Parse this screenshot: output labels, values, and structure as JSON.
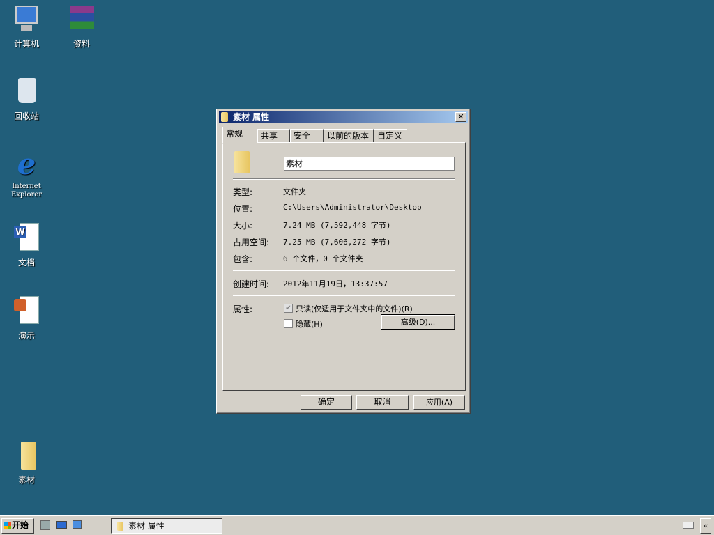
{
  "desktop": {
    "icons": [
      {
        "label": "计算机"
      },
      {
        "label": "资料"
      },
      {
        "label": "回收站"
      },
      {
        "label": "Internet Explorer"
      },
      {
        "label": "文档"
      },
      {
        "label": "演示"
      },
      {
        "label": "素材"
      }
    ]
  },
  "dialog": {
    "title": "素材 属性",
    "close": "✕",
    "tabs": [
      "常规",
      "共享",
      "安全",
      "以前的版本",
      "自定义"
    ],
    "name_value": "素材",
    "rows": [
      {
        "label": "类型:",
        "value": "文件夹"
      },
      {
        "label": "位置:",
        "value": "C:\\Users\\Administrator\\Desktop"
      },
      {
        "label": "大小:",
        "value": "7.24 MB (7,592,448 字节)"
      },
      {
        "label": "占用空间:",
        "value": "7.25 MB (7,606,272 字节)"
      },
      {
        "label": "包含:",
        "value": "6 个文件，0 个文件夹"
      }
    ],
    "created": {
      "label": "创建时间:",
      "value": "2012年11月19日，13:37:57"
    },
    "attributes": {
      "label": "属性:",
      "readonly": "只读(仅适用于文件夹中的文件)(R)",
      "readonly_checked": true,
      "hidden": "隐藏(H)",
      "hidden_checked": false,
      "advanced": "高级(D)..."
    },
    "buttons": {
      "ok": "确定",
      "cancel": "取消",
      "apply": "应用(A)"
    }
  },
  "taskbar": {
    "start": "开始",
    "task": "素材 属性"
  }
}
